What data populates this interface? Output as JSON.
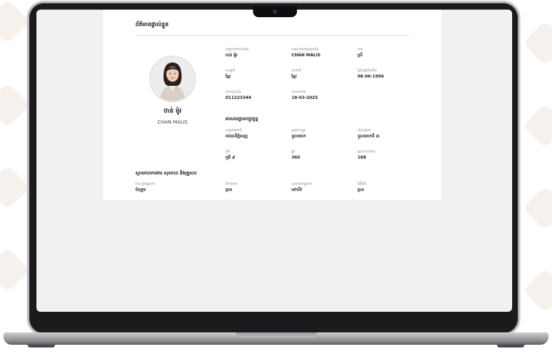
{
  "page": {
    "title": "ព័ត៌មានផ្ទាល់ខ្លួន"
  },
  "profile": {
    "name_km": "ចាន់ ម៉ូរ",
    "name_en": "CHAN MALIS"
  },
  "personal": [
    {
      "label": "ឈ្មោះជាភាសាខ្មែរ",
      "value": "ចាន់ ម៉ូរ"
    },
    {
      "label": "ឈ្មោះជាអក្សរឡាតាំង",
      "value": "CHAN MALIS"
    },
    {
      "label": "ភេទ",
      "value": "ស្រី"
    },
    {
      "label": "សញ្ជាតិ",
      "value": "ខ្មែរ"
    },
    {
      "label": "ជនជាតិ",
      "value": "ខ្មែរ"
    },
    {
      "label": "ថ្ងៃខែឆ្នាំកំណើត",
      "value": "06-06-1996"
    },
    {
      "label": "លេខទូរស័ព្ទ",
      "value": "011223344"
    },
    {
      "label": "សុពលភាព",
      "value": "18-03-2025"
    }
  ],
  "address_section": {
    "title": "អាសយដ្ឋានបច្ចុប្បន្ន",
    "fields": [
      {
        "label": "ខេត្ត/រាជធានី",
        "value": "រាជធានីភ្នំពេញ"
      },
      {
        "label": "ស្រុក/ខណ្ឌ",
        "value": "ទួលគោក"
      },
      {
        "label": "ឃុំ/សង្កាត់",
        "value": "ទួលគោកទី ៣"
      },
      {
        "label": "ភូមិ",
        "value": "ភូមិ ៩"
      },
      {
        "label": "ផ្លូវ",
        "value": "360"
      },
      {
        "label": "ផ្ទះលេខ/អគារ",
        "value": "168"
      }
    ]
  },
  "family_section": {
    "title": "ស្ថានភាពការងារ សុខភាព និងគ្រួសារ",
    "fields": [
      {
        "label": "ឋានៈក្នុងគ្រួសារ",
        "value": "ម៉ាក្រូម"
      },
      {
        "label": "ពិការភាព",
        "value": "គ្មាន"
      },
      {
        "label": "ស្ថានភាពគ្រួសារ",
        "value": "នៅលីវ"
      },
      {
        "label": "ជំងឺរ៉ាំរ៉ៃ",
        "value": "គ្មាន"
      }
    ]
  },
  "colors": {
    "screen_bg": "#f1f1f1",
    "page_bg": "#ffffff",
    "laptop_bezel": "#1b1b1d",
    "text_primary": "#222222",
    "text_label": "#8a8a8a"
  }
}
